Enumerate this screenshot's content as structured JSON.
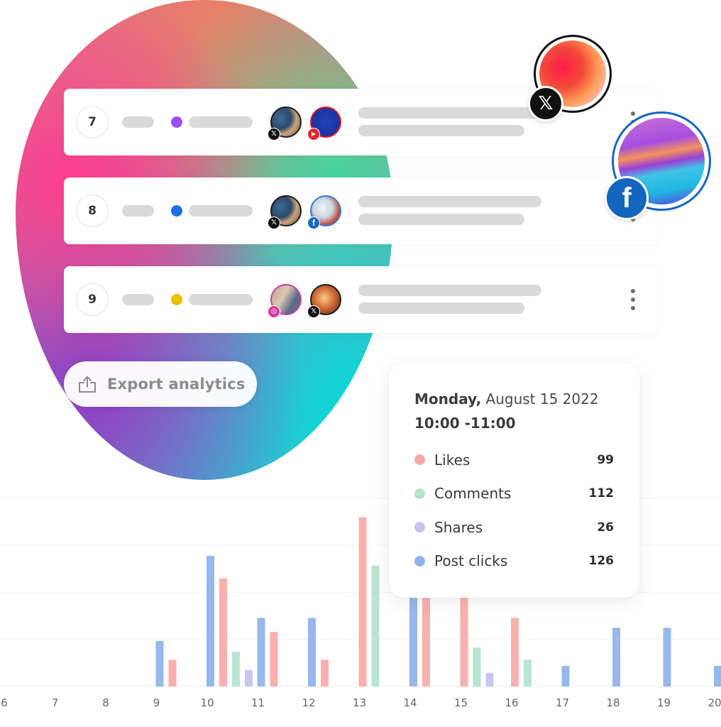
{
  "rows": [
    {
      "rank": "7",
      "status_color": "#9b4dff",
      "accounts": [
        {
          "network": "x",
          "badge_glyph": "𝕏"
        },
        {
          "network": "youtube",
          "badge_glyph": "▶"
        }
      ],
      "has_menu": true
    },
    {
      "rank": "8",
      "status_color": "#1f6fe8",
      "accounts": [
        {
          "network": "x",
          "badge_glyph": "𝕏"
        },
        {
          "network": "facebook",
          "badge_glyph": "f"
        }
      ],
      "has_menu": true
    },
    {
      "rank": "9",
      "status_color": "#eec000",
      "accounts": [
        {
          "network": "instagram",
          "badge_glyph": "◎"
        },
        {
          "network": "x",
          "badge_glyph": "𝕏"
        }
      ],
      "has_menu": true
    }
  ],
  "export_button": {
    "label": "Export analytics",
    "icon": "upload-icon"
  },
  "floating_profiles": [
    {
      "network": "x",
      "badge_glyph": "𝕏"
    },
    {
      "network": "facebook",
      "badge_glyph": "f"
    }
  ],
  "tooltip": {
    "weekday": "Monday,",
    "date": "August 15  2022",
    "time_range": "10:00 -11:00",
    "metrics": [
      {
        "label": "Likes",
        "value": "99",
        "color": "#f7a8a8"
      },
      {
        "label": "Comments",
        "value": "112",
        "color": "#b3e4cc"
      },
      {
        "label": "Shares",
        "value": "26",
        "color": "#c9c3f0"
      },
      {
        "label": "Post clicks",
        "value": "126",
        "color": "#8fb2ec"
      }
    ]
  },
  "chart_data": {
    "type": "bar",
    "title": "",
    "xlabel": "",
    "ylabel": "",
    "categories": [
      "6",
      "7",
      "8",
      "9",
      "10",
      "11",
      "12",
      "13",
      "14",
      "15",
      "16",
      "17",
      "18",
      "19",
      "20"
    ],
    "ylim": [
      0,
      4
    ],
    "grid": true,
    "series": [
      {
        "name": "Post clicks",
        "color": "#97b8ef",
        "values": [
          0,
          0,
          0,
          0.97,
          2.78,
          1.46,
          1.46,
          0,
          2.1,
          0,
          0,
          0.44,
          1.25,
          1.25,
          0.44
        ]
      },
      {
        "name": "Likes",
        "color": "#fbb0b0",
        "values": [
          0,
          0,
          0,
          0.57,
          2.3,
          1.16,
          0.57,
          3.6,
          2.1,
          2.1,
          1.46,
          0,
          0,
          0,
          0
        ]
      },
      {
        "name": "Comments",
        "color": "#b8e6d0",
        "values": [
          0,
          0,
          0,
          0,
          0.74,
          0,
          0,
          2.57,
          0,
          0.83,
          0.57,
          0,
          0,
          0,
          0
        ]
      },
      {
        "name": "Shares",
        "color": "#c8c6f2",
        "values": [
          0,
          0,
          0,
          0,
          0.35,
          0,
          0,
          0,
          0,
          0.29,
          0,
          0,
          0,
          0,
          0
        ]
      }
    ]
  }
}
